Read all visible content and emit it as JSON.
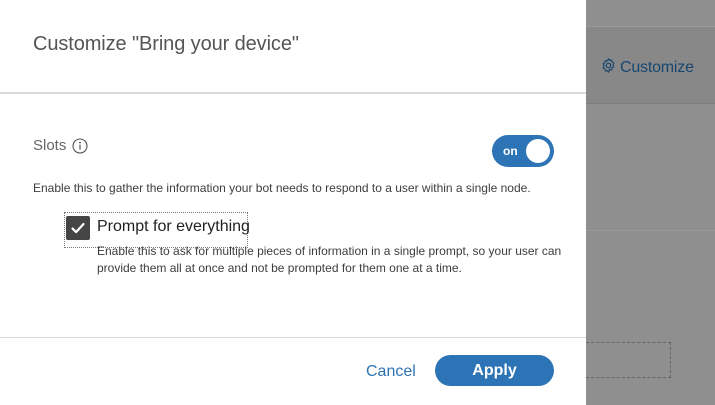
{
  "modal": {
    "title": "Customize \"Bring your device\"",
    "slots": {
      "label": "Slots",
      "info_icon": "info-icon",
      "toggle_state": "on",
      "description": "Enable this to gather the information your bot needs to respond to a user within a single node."
    },
    "prompt_for_everything": {
      "checked": true,
      "label": "Prompt for everything",
      "description": "Enable this to ask for multiple pieces of information in a single prompt, so your user can provide them all at once and not be prompted for them one at a time."
    },
    "footer": {
      "cancel_label": "Cancel",
      "apply_label": "Apply"
    }
  },
  "background": {
    "customize_label": "Customize",
    "customize_icon": "gear-icon"
  },
  "colors": {
    "accent": "#2d74b6",
    "checkbox": "#454545",
    "overlay": "#8a8a8a"
  }
}
